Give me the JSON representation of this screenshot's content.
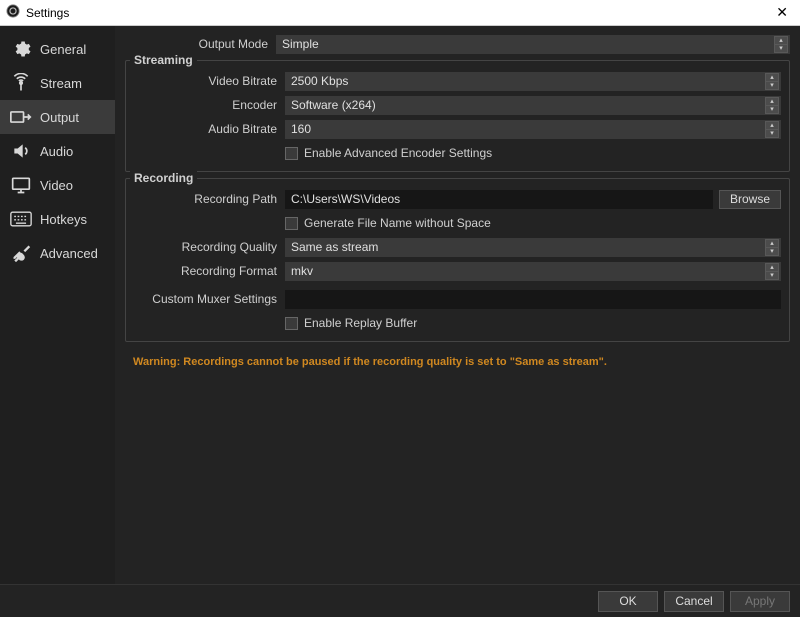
{
  "window": {
    "title": "Settings"
  },
  "sidebar": {
    "items": [
      {
        "label": "General"
      },
      {
        "label": "Stream"
      },
      {
        "label": "Output"
      },
      {
        "label": "Audio"
      },
      {
        "label": "Video"
      },
      {
        "label": "Hotkeys"
      },
      {
        "label": "Advanced"
      }
    ],
    "active_index": 2
  },
  "output_mode": {
    "label": "Output Mode",
    "value": "Simple"
  },
  "streaming": {
    "legend": "Streaming",
    "video_bitrate": {
      "label": "Video Bitrate",
      "value": "2500 Kbps"
    },
    "encoder": {
      "label": "Encoder",
      "value": "Software (x264)"
    },
    "audio_bitrate": {
      "label": "Audio Bitrate",
      "value": "160"
    },
    "advanced_encoder": {
      "label": "Enable Advanced Encoder Settings",
      "checked": false
    }
  },
  "recording": {
    "legend": "Recording",
    "path": {
      "label": "Recording Path",
      "value": "C:\\Users\\WS\\Videos",
      "browse": "Browse"
    },
    "no_space": {
      "label": "Generate File Name without Space",
      "checked": false
    },
    "quality": {
      "label": "Recording Quality",
      "value": "Same as stream"
    },
    "format": {
      "label": "Recording Format",
      "value": "mkv"
    },
    "muxer": {
      "label": "Custom Muxer Settings",
      "value": ""
    },
    "replay": {
      "label": "Enable Replay Buffer",
      "checked": false
    }
  },
  "warning": "Warning: Recordings cannot be paused if the recording quality is set to \"Same as stream\".",
  "buttons": {
    "ok": "OK",
    "cancel": "Cancel",
    "apply": "Apply"
  }
}
